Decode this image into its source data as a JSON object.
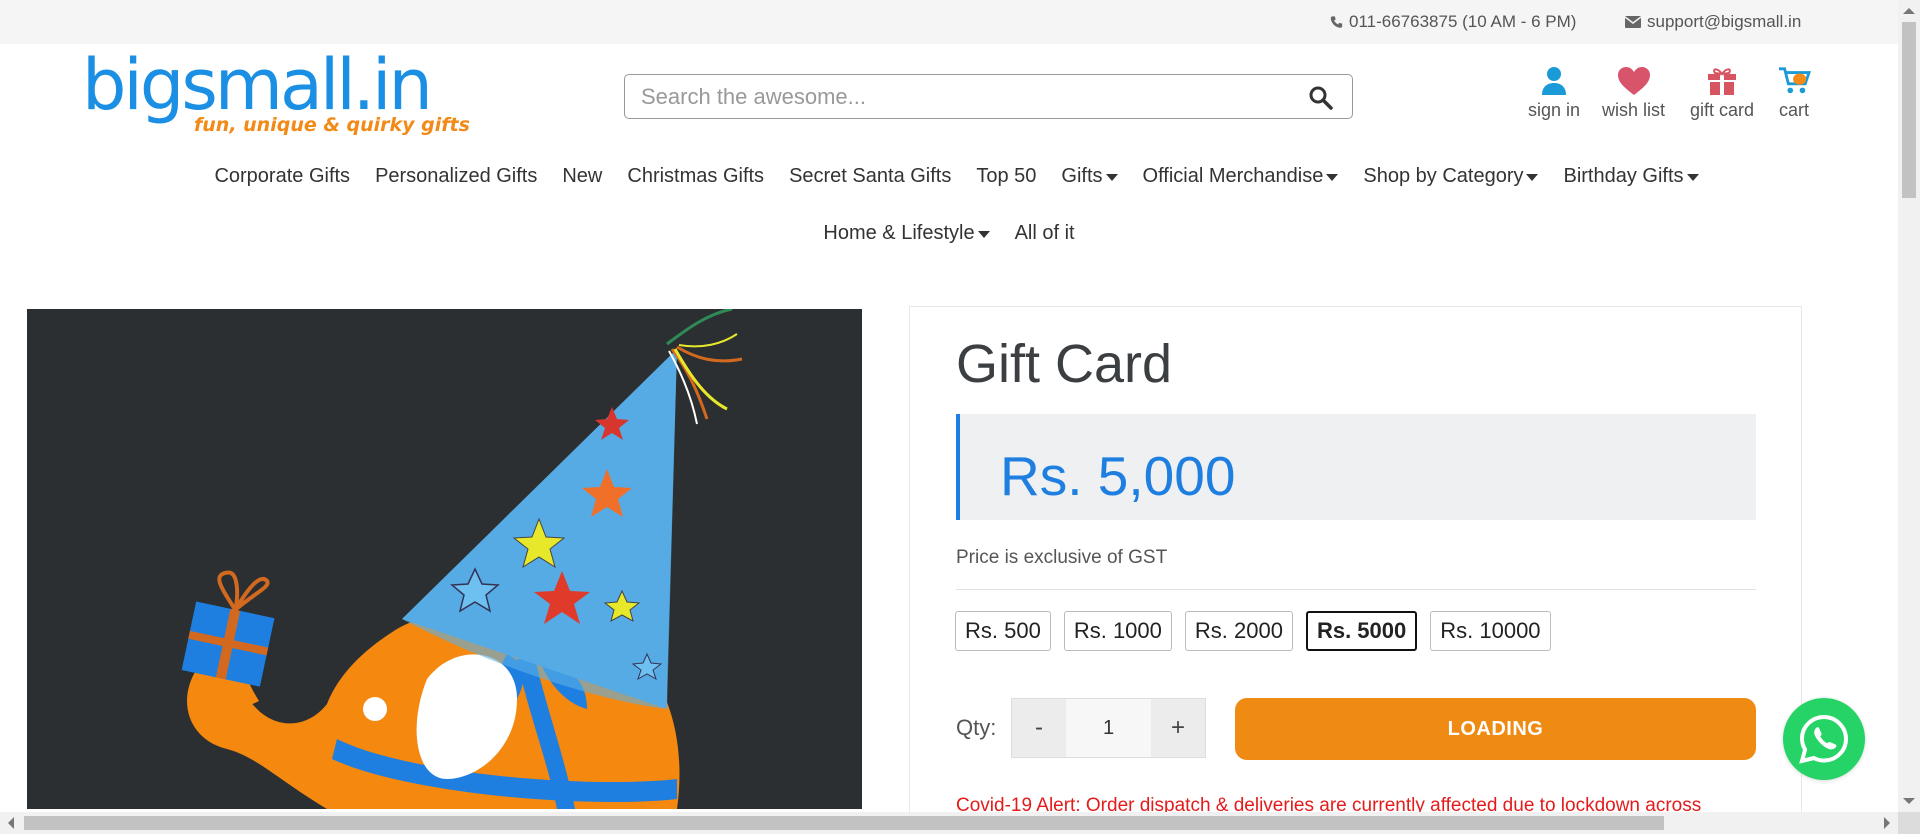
{
  "topbar": {
    "phone": "011-66763875 (10 AM - 6 PM)",
    "email": "support@bigsmall.in"
  },
  "logo": {
    "brand": "bigsmall.in",
    "tagline": "fun, unique & quirky gifts"
  },
  "search": {
    "placeholder": "Search the awesome..."
  },
  "header_icons": [
    {
      "label": "sign in",
      "icon": "user-icon"
    },
    {
      "label": "wish list",
      "icon": "heart-icon"
    },
    {
      "label": "gift card",
      "icon": "gift-icon"
    },
    {
      "label": "cart",
      "icon": "cart-icon"
    }
  ],
  "nav": {
    "row1": [
      {
        "label": "Corporate Gifts",
        "dropdown": false
      },
      {
        "label": "Personalized Gifts",
        "dropdown": false
      },
      {
        "label": "New",
        "dropdown": false
      },
      {
        "label": "Christmas Gifts",
        "dropdown": false
      },
      {
        "label": "Secret Santa Gifts",
        "dropdown": false
      },
      {
        "label": "Top 50",
        "dropdown": false
      },
      {
        "label": "Gifts",
        "dropdown": true
      },
      {
        "label": "Official Merchandise",
        "dropdown": true
      },
      {
        "label": "Shop by Category",
        "dropdown": true
      },
      {
        "label": "Birthday Gifts",
        "dropdown": true
      }
    ],
    "row2": [
      {
        "label": "Home & Lifestyle",
        "dropdown": true
      },
      {
        "label": "All of it",
        "dropdown": false
      }
    ]
  },
  "product": {
    "title": "Gift Card",
    "price": "Rs. 5,000",
    "gst_note": "Price is exclusive of GST",
    "denominations": [
      "Rs. 500",
      "Rs. 1000",
      "Rs. 2000",
      "Rs. 5000",
      "Rs. 10000"
    ],
    "selected_denomination": "Rs. 5000",
    "qty_label": "Qty:",
    "qty_minus": "-",
    "qty_value": "1",
    "qty_plus": "+",
    "add_button": "LOADING",
    "alert": "Covid-19 Alert: Order dispatch & deliveries are currently affected due to lockdown across"
  },
  "colors": {
    "brand_blue": "#1a8fe3",
    "brand_orange": "#f28a17",
    "price_blue": "#1f7fe0",
    "button_orange": "#ef8a12",
    "alert_red": "#e41b1b",
    "whatsapp_green": "#25d366"
  }
}
